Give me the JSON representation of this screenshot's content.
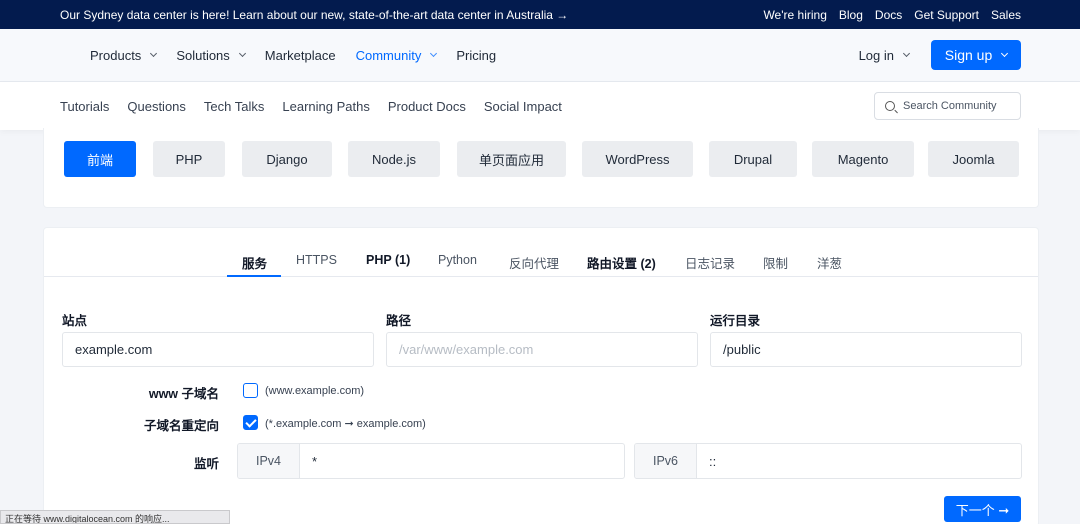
{
  "announcement": {
    "text": "Our Sydney data center is here! Learn about our new, state-of-the-art data center in Australia →",
    "links": [
      "We're hiring",
      "Blog",
      "Docs",
      "Get Support",
      "Sales"
    ]
  },
  "nav": {
    "products": "Products",
    "solutions": "Solutions",
    "marketplace": "Marketplace",
    "community": "Community",
    "pricing": "Pricing",
    "login": "Log in",
    "signup": "Sign up"
  },
  "subnav": {
    "links": [
      "Tutorials",
      "Questions",
      "Tech Talks",
      "Learning Paths",
      "Product Docs",
      "Social Impact"
    ],
    "search_placeholder": "Search Community"
  },
  "tech_buttons": [
    "前端",
    "PHP",
    "Django",
    "Node.js",
    "单页面应用",
    "WordPress",
    "Drupal",
    "Magento",
    "Joomla"
  ],
  "tabs": [
    "服务",
    "HTTPS",
    "PHP (1)",
    "Python",
    "反向代理",
    "路由设置 (2)",
    "日志记录",
    "限制",
    "洋葱"
  ],
  "form": {
    "site_label": "站点",
    "site_value": "example.com",
    "path_label": "路径",
    "path_placeholder": "/var/www/example.com",
    "docroot_label": "运行目录",
    "docroot_value": "/public",
    "www_label": "www 子域名",
    "www_hint": "(www.example.com)",
    "redirect_label": "子域名重定向",
    "redirect_hint": "(*.example.com ➞ example.com)",
    "listen_label": "监听",
    "ipv4_label": "IPv4",
    "ipv4_value": "*",
    "ipv6_label": "IPv6",
    "ipv6_value": "::",
    "next_label": "下一个 ➞"
  },
  "status_text": "正在等待 www.digitalocean.com 的响应..."
}
